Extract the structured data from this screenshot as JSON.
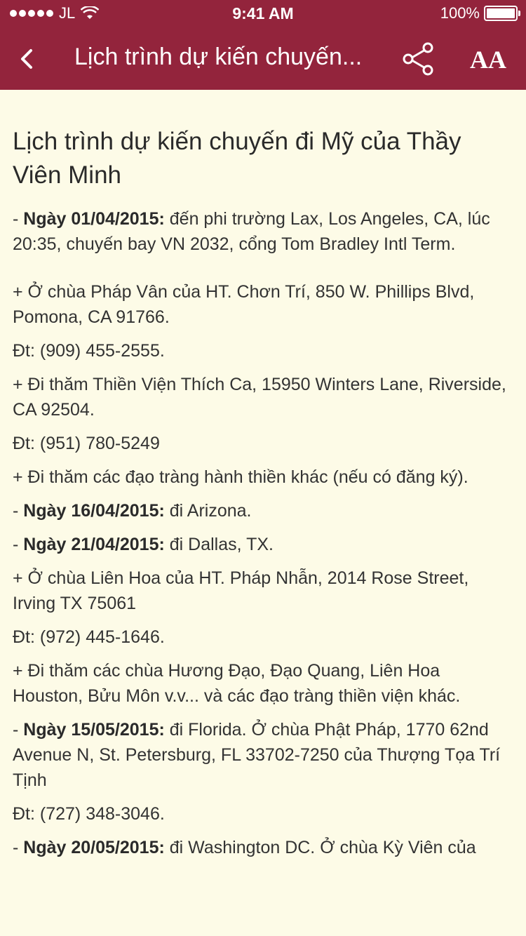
{
  "status_bar": {
    "carrier": "JL",
    "time": "9:41 AM",
    "battery": "100%"
  },
  "nav": {
    "title": "Lịch trình dự kiến chuyến...",
    "back_icon": "chevron-left-icon",
    "share_icon": "share-icon",
    "font_size_label": "AA"
  },
  "colors": {
    "accent": "#93243c",
    "background": "#fdfbe7"
  },
  "article": {
    "title": "Lịch trình dự kiến chuyến đi Mỹ của Thầy Viên Minh",
    "paragraphs": [
      {
        "prefix": "- ",
        "bold": "Ngày 01/04/2015:",
        "text": " đến phi trường Lax, Los Angeles, CA, lúc 20:35, chuyến bay VN 2032, cổng Tom Bradley Intl Term."
      },
      {
        "prefix": "",
        "bold": "",
        "text": "+ Ở chùa Pháp Vân của HT. Chơn Trí, 850 W. Phillips Blvd, Pomona, CA 91766."
      },
      {
        "prefix": "",
        "bold": "",
        "text": "Đt: (909) 455-2555."
      },
      {
        "prefix": "",
        "bold": "",
        "text": "+ Đi thăm Thiền Viện Thích Ca, 15950 Winters Lane, Riverside, CA 92504."
      },
      {
        "prefix": "",
        "bold": "",
        "text": "Đt: (951) 780-5249"
      },
      {
        "prefix": "",
        "bold": "",
        "text": "+ Đi thăm các đạo tràng hành thiền khác (nếu có đăng ký)."
      },
      {
        "prefix": "- ",
        "bold": "Ngày 16/04/2015:",
        "text": " đi Arizona."
      },
      {
        "prefix": "- ",
        "bold": "Ngày 21/04/2015:",
        "text": " đi Dallas, TX."
      },
      {
        "prefix": "",
        "bold": "",
        "text": "+ Ở chùa Liên Hoa của HT. Pháp Nhẫn, 2014 Rose Street, Irving TX 75061"
      },
      {
        "prefix": "",
        "bold": "",
        "text": "Đt: (972) 445-1646."
      },
      {
        "prefix": "",
        "bold": "",
        "text": "+ Đi thăm các chùa Hương Đạo, Đạo Quang, Liên Hoa Houston, Bửu Môn v.v... và các đạo tràng thiền viện khác."
      },
      {
        "prefix": "- ",
        "bold": "Ngày 15/05/2015:",
        "text": " đi Florida. Ở chùa Phật Pháp, 1770 62nd Avenue N, St. Petersburg, FL 33702-7250 của Thượng Tọa Trí Tịnh"
      },
      {
        "prefix": "",
        "bold": "",
        "text": "Đt: (727) 348-3046."
      },
      {
        "prefix": "- ",
        "bold": "Ngày 20/05/2015:",
        "text": " đi Washington DC. Ở chùa Kỳ Viên của"
      }
    ]
  }
}
